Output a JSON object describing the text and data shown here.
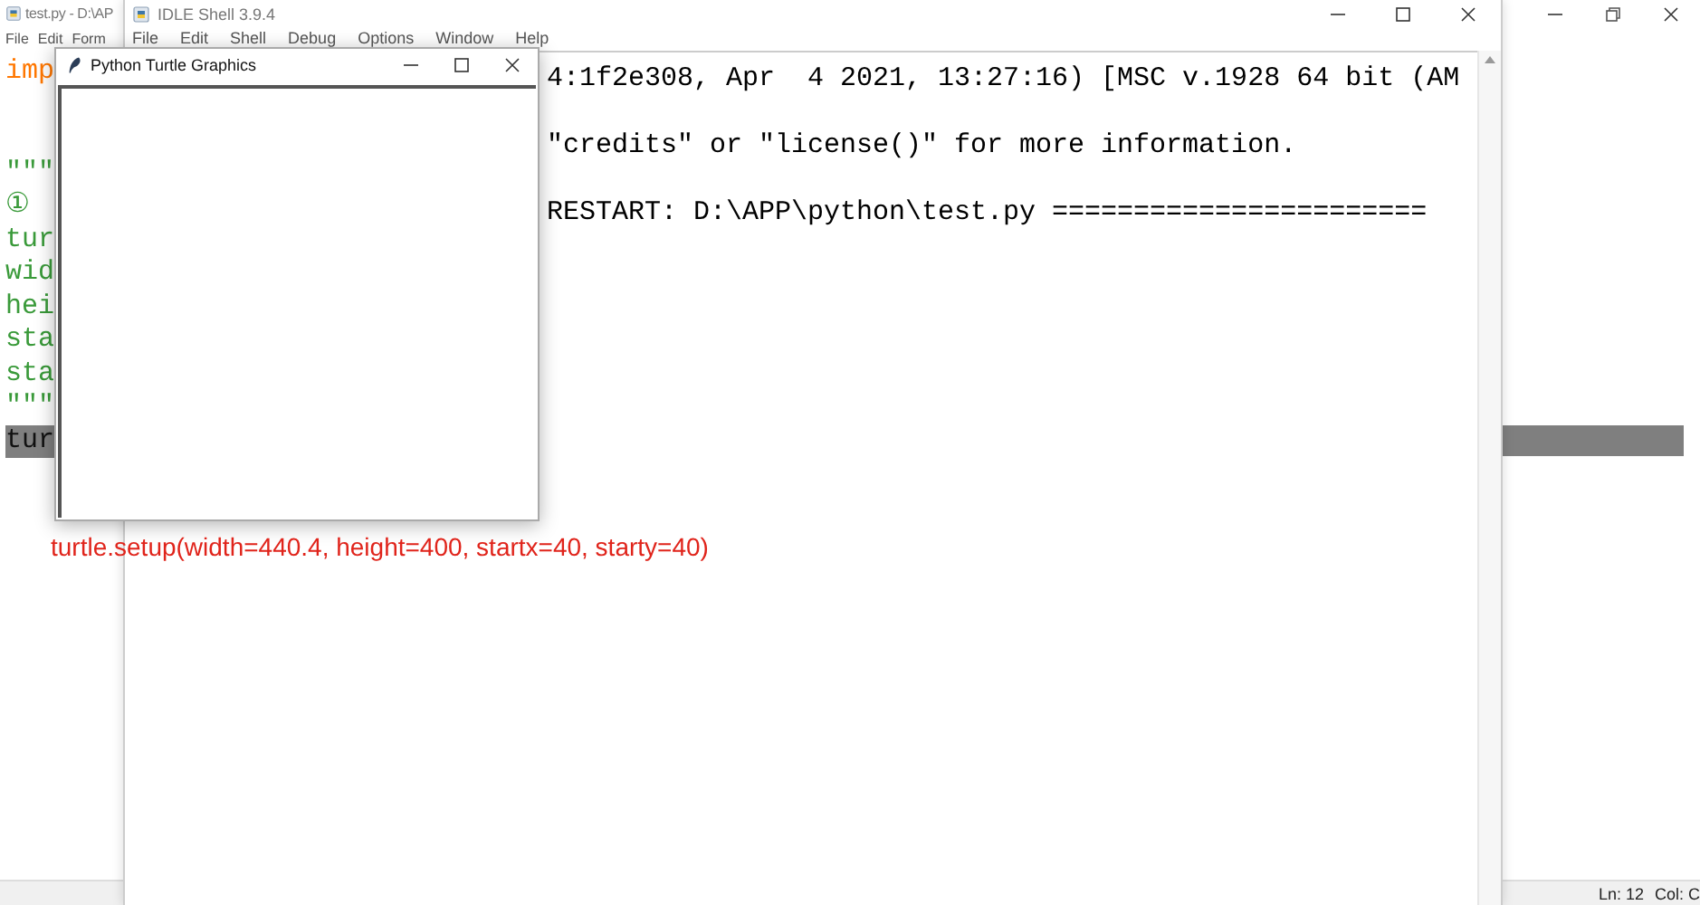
{
  "editor_window": {
    "title": "test.py - D:\\AP",
    "menu": [
      "File",
      "Edit",
      "Form"
    ],
    "code_lines": [
      {
        "text": "imp",
        "kind": "keyword",
        "selected": false
      },
      {
        "text": "\"\"\"",
        "kind": "string",
        "selected": false
      },
      {
        "text": "①",
        "kind": "string",
        "selected": false
      },
      {
        "text": "tur",
        "kind": "string",
        "selected": false
      },
      {
        "text": "wid",
        "kind": "string",
        "selected": false
      },
      {
        "text": "hei",
        "kind": "string",
        "selected": false
      },
      {
        "text": "sta",
        "kind": "string",
        "selected": false
      },
      {
        "text": "sta",
        "kind": "string",
        "selected": false
      },
      {
        "text": "\"\"\"",
        "kind": "string",
        "selected": false
      },
      {
        "text": "tur",
        "kind": "plain",
        "selected": true
      }
    ],
    "status_bar": {
      "line": "Ln: 12",
      "column": "Col: C"
    }
  },
  "shell_window": {
    "title": "IDLE Shell 3.9.4",
    "menu": [
      "File",
      "Edit",
      "Shell",
      "Debug",
      "Options",
      "Window",
      "Help"
    ],
    "output_lines": [
      "4:1f2e308, Apr  4 2021, 13:27:16) [MSC v.1928 64 bit (AM",
      "\"credits\" or \"license()\" for more information.",
      "RESTART: D:\\APP\\python\\test.py ======================="
    ]
  },
  "turtle_window": {
    "title": "Python Turtle Graphics"
  },
  "annotation": {
    "text": "turtle.setup(width=440.4, height=400, startx=40, starty=40)"
  }
}
